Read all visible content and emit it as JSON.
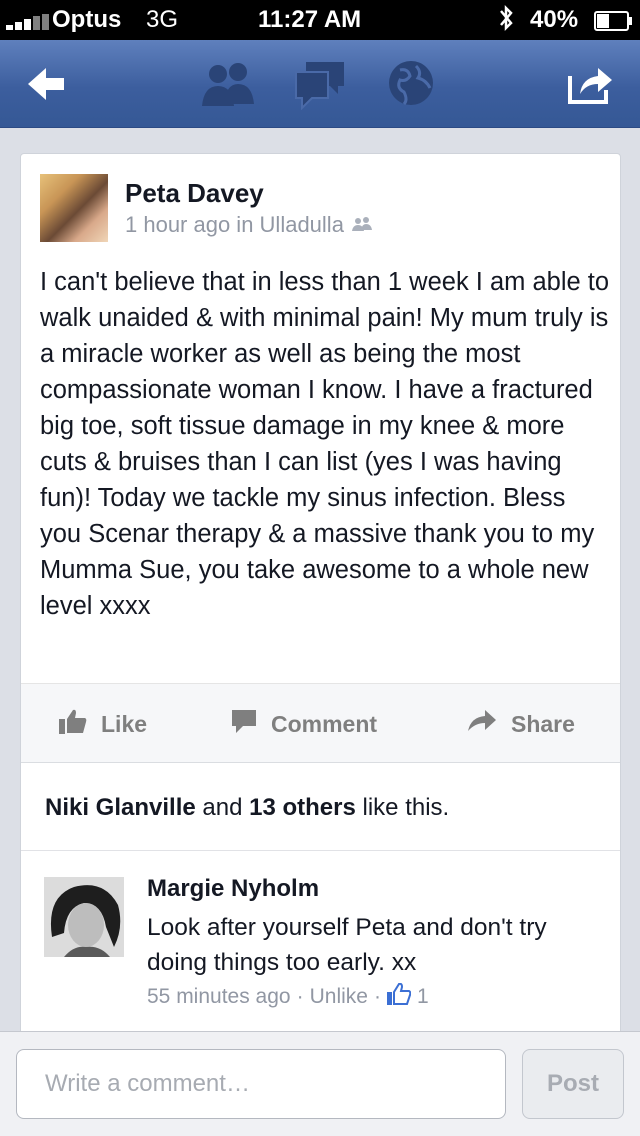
{
  "status_bar": {
    "carrier": "Optus",
    "network": "3G",
    "time": "11:27 AM",
    "battery": "40%",
    "battery_level": 0.4
  },
  "nav": {
    "icons": [
      "back-arrow-icon",
      "friends-icon",
      "messages-icon",
      "globe-icon",
      "share-out-icon"
    ]
  },
  "post": {
    "author": "Peta Davey",
    "meta": "1 hour ago in Ulladulla",
    "body": "I can't believe that in less than 1 week I am able to walk unaided & with minimal pain! My mum truly is a miracle worker as well as being the most compassionate woman I know. I have a fractured big toe, soft tissue damage in my knee & more cuts & bruises than I can list (yes I was having fun)! Today we tackle my sinus infection. Bless you Scenar therapy & a massive thank you to my Mumma Sue, you take awesome to a whole new level xxxx",
    "actions": {
      "like": "Like",
      "comment": "Comment",
      "share": "Share"
    },
    "likes": {
      "name": "Niki Glanville",
      "and": "and",
      "count": "13 others",
      "suffix": "like this."
    }
  },
  "comment": {
    "author": "Margie Nyholm",
    "text": "Look after yourself Peta and don't try doing things too early. xx",
    "time": "55 minutes ago",
    "sep": "·",
    "unlike": "Unlike",
    "like_count": "1"
  },
  "composer": {
    "placeholder": "Write a comment…",
    "post_label": "Post"
  },
  "colors": {
    "nav_blue": "#3c5e9e",
    "link_blue": "#3b5998",
    "meta_gray": "#9197a3"
  }
}
